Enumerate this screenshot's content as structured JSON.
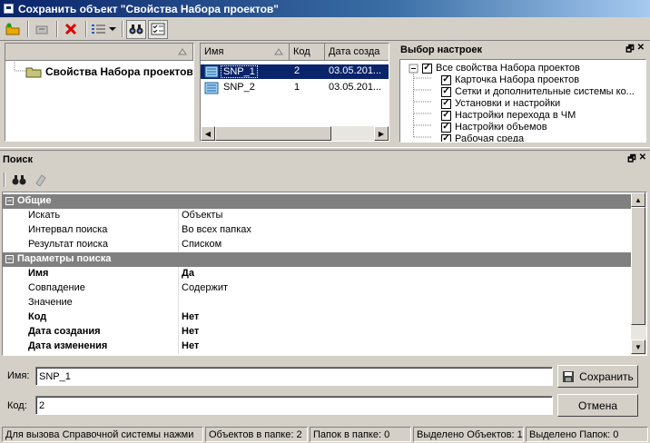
{
  "window": {
    "title": "Сохранить объект \"Свойства Набора проектов\""
  },
  "left_tree": {
    "root": "Свойства Набора проектов"
  },
  "objects_table": {
    "columns": [
      "Имя",
      "Код",
      "Дата созда"
    ],
    "rows": [
      {
        "name": "SNP_1",
        "code": "2",
        "date": "03.05.201..."
      },
      {
        "name": "SNP_2",
        "code": "1",
        "date": "03.05.201..."
      }
    ]
  },
  "settings_pane": {
    "title": "Выбор настроек",
    "root": "Все свойства Набора проектов",
    "items": [
      "Карточка Набора проектов",
      "Сетки и дополнительные системы ко...",
      "Установки и настройки",
      "Настройки перехода в ЧМ",
      "Настройки объемов",
      "Рабочая среда"
    ]
  },
  "search_pane": {
    "title": "Поиск",
    "cat_general": "Общие",
    "search_label": "Искать",
    "search_value": "Объекты",
    "interval_label": "Интервал поиска",
    "interval_value": "Во всех папках",
    "result_label": "Результат поиска",
    "result_value": "Списком",
    "cat_params": "Параметры поиска",
    "name_label": "Имя",
    "name_value": "Да",
    "match_label": "Совпадение",
    "match_value": "Содержит",
    "value_label": "Значение",
    "value_value": "",
    "code_label": "Код",
    "code_value": "Нет",
    "created_label": "Дата создания",
    "created_value": "Нет",
    "modified_label": "Дата изменения",
    "modified_value": "Нет"
  },
  "form": {
    "name_label": "Имя:",
    "name_value": "SNP_1",
    "code_label": "Код:",
    "code_value": "2",
    "save_label": "Сохранить",
    "cancel_label": "Отмена"
  },
  "status": {
    "help": "Для вызова Справочной системы нажми",
    "objects": "Объектов в папке: 2",
    "folders": "Папок в папке: 0",
    "sel_objects": "Выделено Объектов: 1",
    "sel_folders": "Выделено Папок: 0"
  }
}
